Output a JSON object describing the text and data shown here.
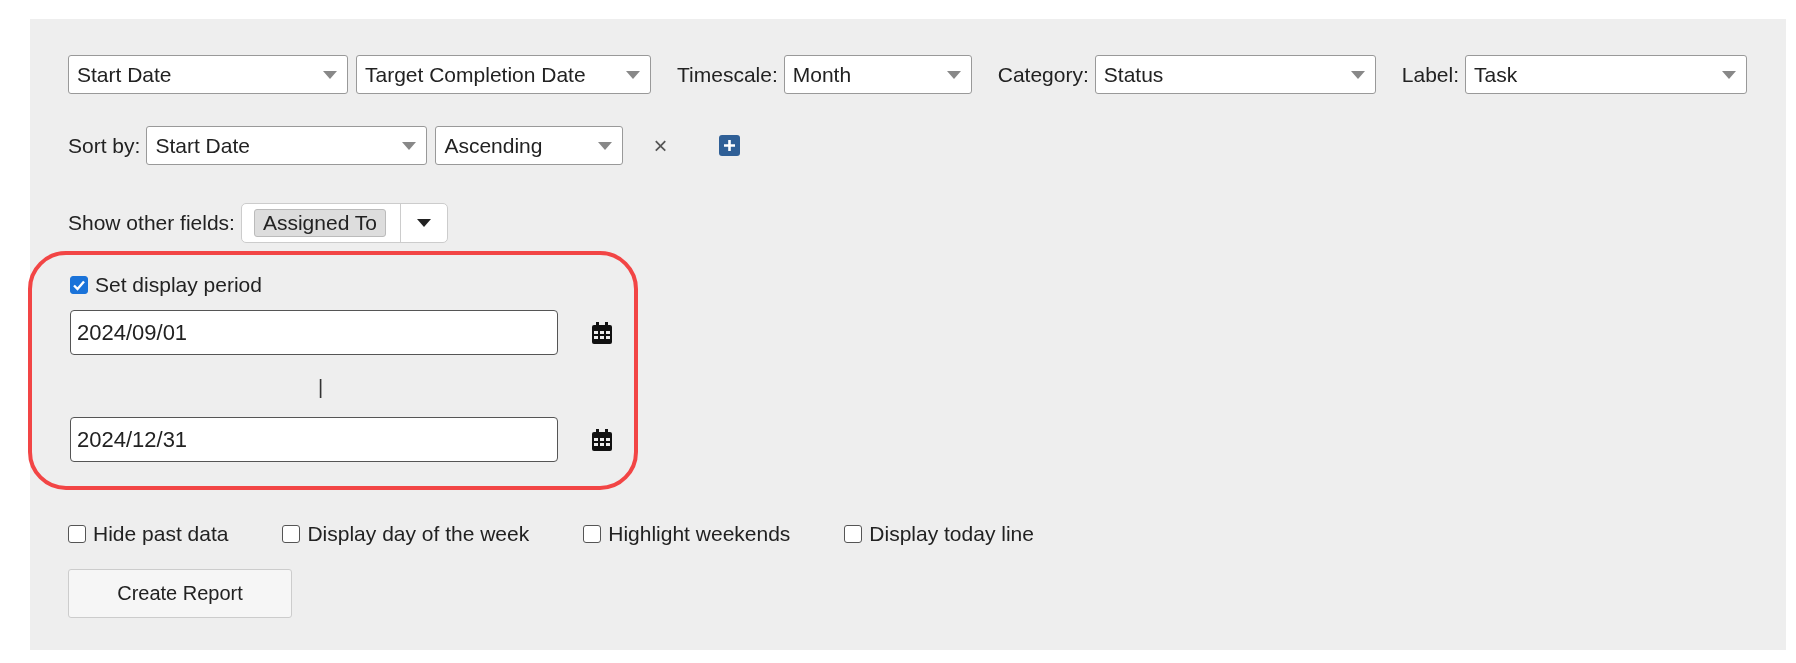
{
  "report_fields": [
    {
      "value": "Start Date"
    },
    {
      "value": "Target Completion Date"
    },
    {
      "label": "Timescale:",
      "value": "Month"
    },
    {
      "label": "Category:",
      "value": "Status"
    },
    {
      "label": "Label:",
      "value": "Task"
    }
  ],
  "sort": {
    "label": "Sort by:",
    "field": "Start Date",
    "order": "Ascending",
    "remove": "×"
  },
  "other_fields": {
    "label": "Show other fields:",
    "chips": [
      "Assigned To"
    ]
  },
  "display_period": {
    "label": "Set display period",
    "checked": true,
    "start": "2024/09/01",
    "separator": "|",
    "end": "2024/12/31",
    "highlighted": true
  },
  "options": [
    {
      "label": "Hide past data",
      "checked": false
    },
    {
      "label": "Display day of the week",
      "checked": false
    },
    {
      "label": "Highlight weekends",
      "checked": false
    },
    {
      "label": "Display today line",
      "checked": false
    }
  ],
  "button": "Create Report"
}
